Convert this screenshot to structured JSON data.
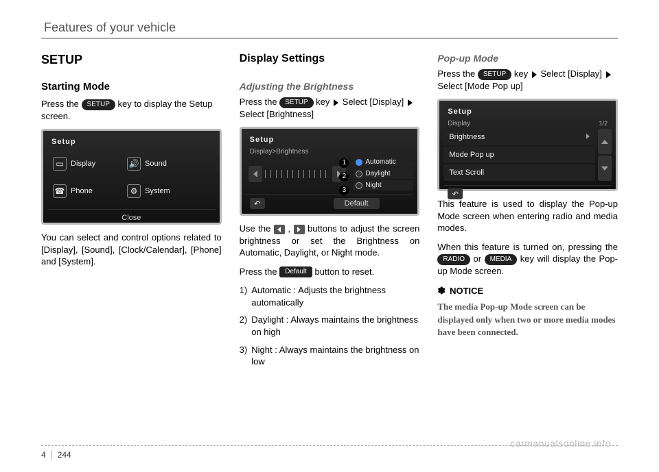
{
  "header": {
    "title": "Features of your vehicle"
  },
  "footer": {
    "chapter": "4",
    "page": "244"
  },
  "watermark": "carmanualsonline.info",
  "col1": {
    "h2": "SETUP",
    "h3": "Starting Mode",
    "p1a": "Press the ",
    "p1_key": "SETUP",
    "p1b": " key to display the Setup screen.",
    "screen": {
      "title": "Setup",
      "items": {
        "display": "Display",
        "sound": "Sound",
        "phone": "Phone",
        "system": "System"
      },
      "close": "Close"
    },
    "p2": "You can select and control options related to [Display], [Sound], [Clock/Calendar], [Phone] and [System]."
  },
  "col2": {
    "h3a": "Display Settings",
    "h3b": "Adjusting the Brightness",
    "p1a": "Press the ",
    "p1_key": "SETUP",
    "p1b": " key",
    "p1c": "Select [Display] ",
    "p1d": "Select [Brightness]",
    "screen": {
      "title": "Setup",
      "crumb": "Display>Brightness",
      "modes": {
        "auto": "Automatic",
        "day": "Daylight",
        "night": "Night"
      },
      "default": "Default"
    },
    "p2a": "Use the ",
    "p2b": ", ",
    "p2c": " buttons to adjust the screen brightness or set the Brightness on Automatic, Daylight, or Night mode.",
    "p3a": "Press the ",
    "p3_key": "Default",
    "p3b": " button to reset.",
    "list": {
      "n1": "1)",
      "t1": "Automatic : Adjusts the brightness automatically",
      "n2": "2)",
      "t2": "Daylight : Always maintains the brightness on high",
      "n3": "3)",
      "t3": "Night : Always maintains the brightness on low"
    }
  },
  "col3": {
    "h3": "Pop-up Mode",
    "p1a": "Press the ",
    "p1_key": "SETUP",
    "p1b": " key",
    "p1c": "Select [Display] ",
    "p1d": "Select [Mode Pop up]",
    "screen": {
      "title": "Setup",
      "crumb": "Display",
      "page": "1/2",
      "rows": {
        "brightness": "Brightness",
        "popup": "Mode Pop up",
        "scroll": "Text Scroll"
      }
    },
    "p2": "This feature is used to display the Pop-up Mode screen when entering radio and media modes.",
    "p3a": "When this feature is turned on, pressing the ",
    "p3_key1": "RADIO",
    "p3b": " or ",
    "p3_key2": "MEDIA",
    "p3c": " key will display the Pop-up Mode screen.",
    "notice_star": "✽",
    "notice_head": "NOTICE",
    "notice_body": "The media Pop-up Mode screen can be displayed only when two or more media modes have been connected."
  }
}
